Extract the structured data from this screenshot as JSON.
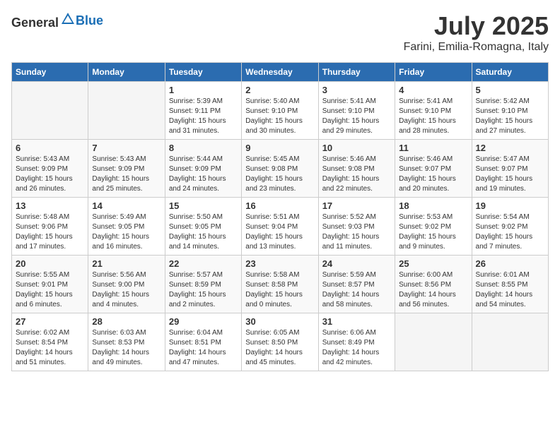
{
  "header": {
    "logo": {
      "general": "General",
      "blue": "Blue"
    },
    "month": "July 2025",
    "location": "Farini, Emilia-Romagna, Italy"
  },
  "weekdays": [
    "Sunday",
    "Monday",
    "Tuesday",
    "Wednesday",
    "Thursday",
    "Friday",
    "Saturday"
  ],
  "weeks": [
    [
      {
        "day": "",
        "empty": true
      },
      {
        "day": "",
        "empty": true
      },
      {
        "day": "1",
        "sunrise": "5:39 AM",
        "sunset": "9:11 PM",
        "daylight": "15 hours and 31 minutes."
      },
      {
        "day": "2",
        "sunrise": "5:40 AM",
        "sunset": "9:10 PM",
        "daylight": "15 hours and 30 minutes."
      },
      {
        "day": "3",
        "sunrise": "5:41 AM",
        "sunset": "9:10 PM",
        "daylight": "15 hours and 29 minutes."
      },
      {
        "day": "4",
        "sunrise": "5:41 AM",
        "sunset": "9:10 PM",
        "daylight": "15 hours and 28 minutes."
      },
      {
        "day": "5",
        "sunrise": "5:42 AM",
        "sunset": "9:10 PM",
        "daylight": "15 hours and 27 minutes."
      }
    ],
    [
      {
        "day": "6",
        "sunrise": "5:43 AM",
        "sunset": "9:09 PM",
        "daylight": "15 hours and 26 minutes."
      },
      {
        "day": "7",
        "sunrise": "5:43 AM",
        "sunset": "9:09 PM",
        "daylight": "15 hours and 25 minutes."
      },
      {
        "day": "8",
        "sunrise": "5:44 AM",
        "sunset": "9:09 PM",
        "daylight": "15 hours and 24 minutes."
      },
      {
        "day": "9",
        "sunrise": "5:45 AM",
        "sunset": "9:08 PM",
        "daylight": "15 hours and 23 minutes."
      },
      {
        "day": "10",
        "sunrise": "5:46 AM",
        "sunset": "9:08 PM",
        "daylight": "15 hours and 22 minutes."
      },
      {
        "day": "11",
        "sunrise": "5:46 AM",
        "sunset": "9:07 PM",
        "daylight": "15 hours and 20 minutes."
      },
      {
        "day": "12",
        "sunrise": "5:47 AM",
        "sunset": "9:07 PM",
        "daylight": "15 hours and 19 minutes."
      }
    ],
    [
      {
        "day": "13",
        "sunrise": "5:48 AM",
        "sunset": "9:06 PM",
        "daylight": "15 hours and 17 minutes."
      },
      {
        "day": "14",
        "sunrise": "5:49 AM",
        "sunset": "9:05 PM",
        "daylight": "15 hours and 16 minutes."
      },
      {
        "day": "15",
        "sunrise": "5:50 AM",
        "sunset": "9:05 PM",
        "daylight": "15 hours and 14 minutes."
      },
      {
        "day": "16",
        "sunrise": "5:51 AM",
        "sunset": "9:04 PM",
        "daylight": "15 hours and 13 minutes."
      },
      {
        "day": "17",
        "sunrise": "5:52 AM",
        "sunset": "9:03 PM",
        "daylight": "15 hours and 11 minutes."
      },
      {
        "day": "18",
        "sunrise": "5:53 AM",
        "sunset": "9:02 PM",
        "daylight": "15 hours and 9 minutes."
      },
      {
        "day": "19",
        "sunrise": "5:54 AM",
        "sunset": "9:02 PM",
        "daylight": "15 hours and 7 minutes."
      }
    ],
    [
      {
        "day": "20",
        "sunrise": "5:55 AM",
        "sunset": "9:01 PM",
        "daylight": "15 hours and 6 minutes."
      },
      {
        "day": "21",
        "sunrise": "5:56 AM",
        "sunset": "9:00 PM",
        "daylight": "15 hours and 4 minutes."
      },
      {
        "day": "22",
        "sunrise": "5:57 AM",
        "sunset": "8:59 PM",
        "daylight": "15 hours and 2 minutes."
      },
      {
        "day": "23",
        "sunrise": "5:58 AM",
        "sunset": "8:58 PM",
        "daylight": "15 hours and 0 minutes."
      },
      {
        "day": "24",
        "sunrise": "5:59 AM",
        "sunset": "8:57 PM",
        "daylight": "14 hours and 58 minutes."
      },
      {
        "day": "25",
        "sunrise": "6:00 AM",
        "sunset": "8:56 PM",
        "daylight": "14 hours and 56 minutes."
      },
      {
        "day": "26",
        "sunrise": "6:01 AM",
        "sunset": "8:55 PM",
        "daylight": "14 hours and 54 minutes."
      }
    ],
    [
      {
        "day": "27",
        "sunrise": "6:02 AM",
        "sunset": "8:54 PM",
        "daylight": "14 hours and 51 minutes."
      },
      {
        "day": "28",
        "sunrise": "6:03 AM",
        "sunset": "8:53 PM",
        "daylight": "14 hours and 49 minutes."
      },
      {
        "day": "29",
        "sunrise": "6:04 AM",
        "sunset": "8:51 PM",
        "daylight": "14 hours and 47 minutes."
      },
      {
        "day": "30",
        "sunrise": "6:05 AM",
        "sunset": "8:50 PM",
        "daylight": "14 hours and 45 minutes."
      },
      {
        "day": "31",
        "sunrise": "6:06 AM",
        "sunset": "8:49 PM",
        "daylight": "14 hours and 42 minutes."
      },
      {
        "day": "",
        "empty": true
      },
      {
        "day": "",
        "empty": true
      }
    ]
  ],
  "labels": {
    "sunrise_prefix": "Sunrise: ",
    "sunset_prefix": "Sunset: ",
    "daylight_prefix": "Daylight: "
  }
}
